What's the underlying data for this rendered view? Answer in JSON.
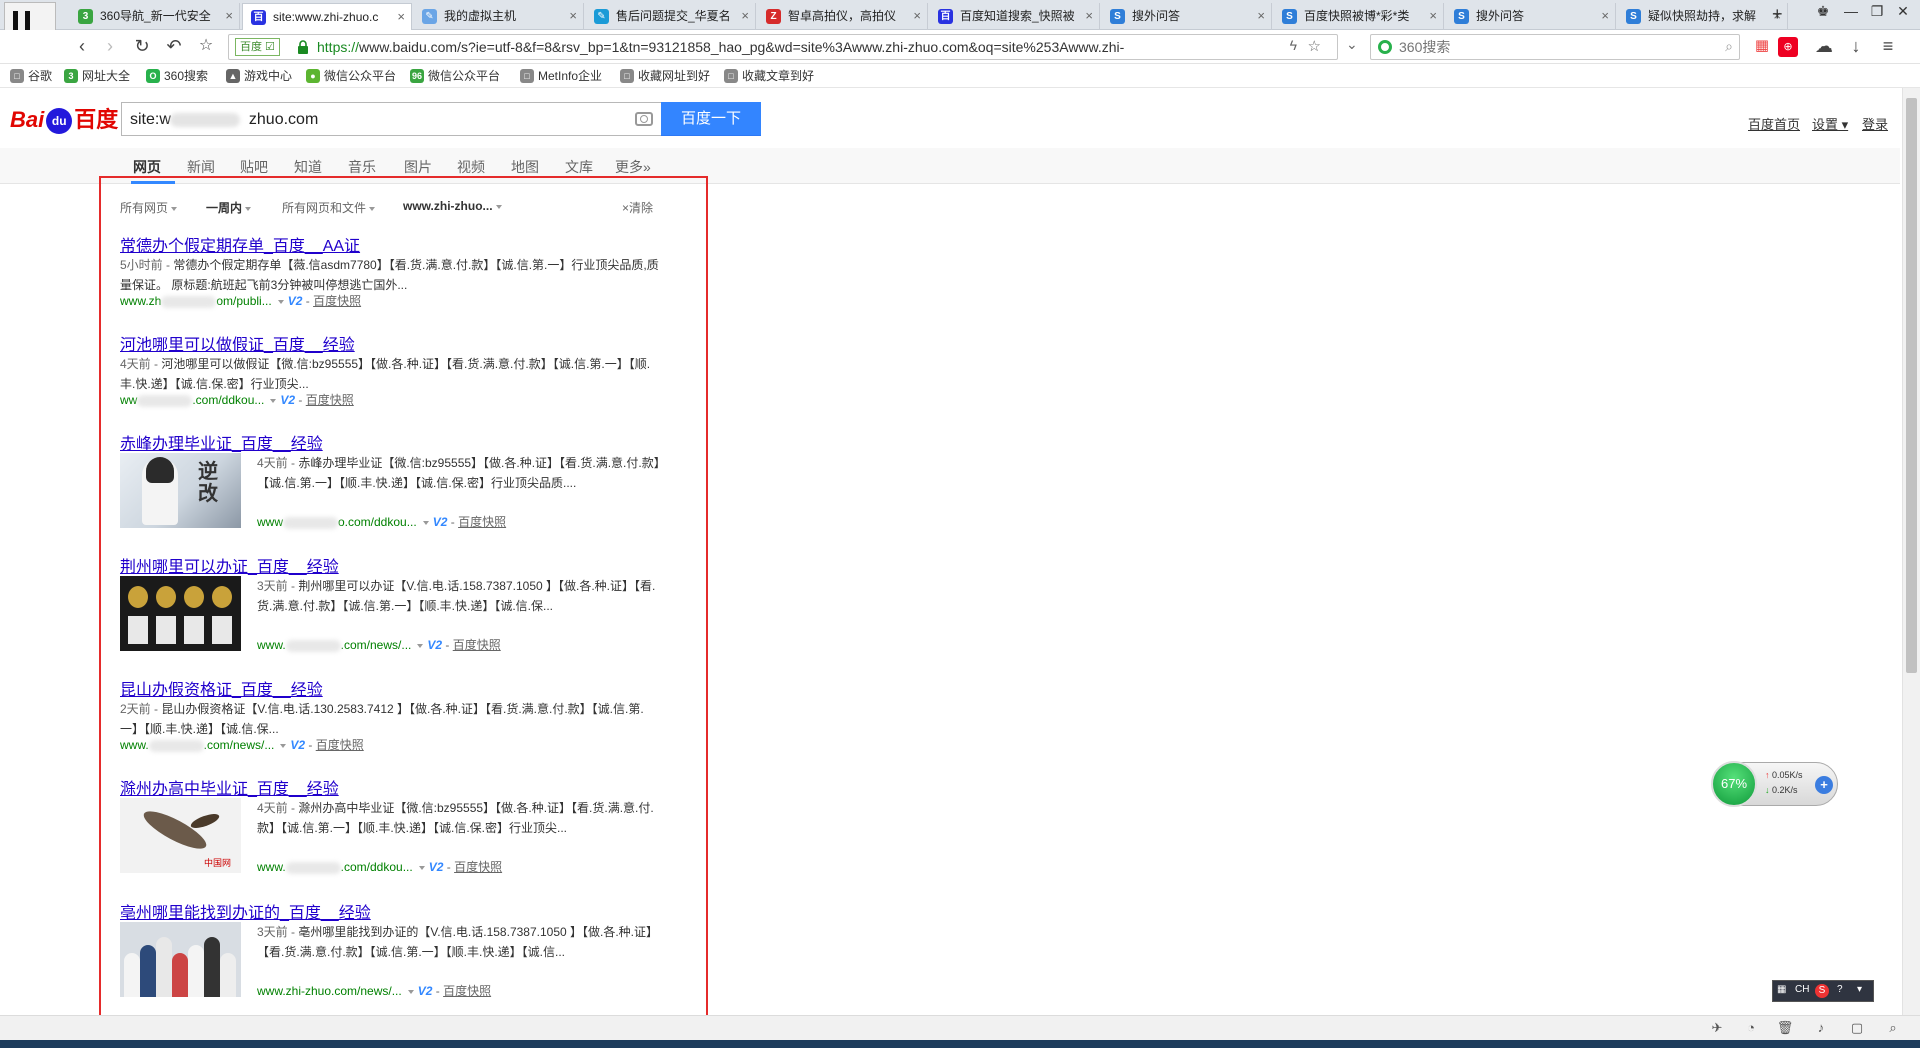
{
  "tabs": [
    {
      "label": "360导航_新一代安全",
      "fav_color": "#3aa541",
      "fav_text": "3",
      "active": false
    },
    {
      "label": "site:www.zhi-zhuo.c",
      "fav_color": "#2932e1",
      "fav_text": "百",
      "active": true
    },
    {
      "label": "我的虚拟主机",
      "fav_color": "#6aa5e6",
      "fav_text": "✎",
      "active": false
    },
    {
      "label": "售后问题提交_华夏名",
      "fav_color": "#1b9bd7",
      "fav_text": "✎",
      "active": false
    },
    {
      "label": "智卓高拍仪，高拍仪",
      "fav_color": "#d62b2b",
      "fav_text": "Z",
      "active": false
    },
    {
      "label": "百度知道搜索_快照被",
      "fav_color": "#2932e1",
      "fav_text": "百",
      "active": false
    },
    {
      "label": "搜外问答",
      "fav_color": "#2f7ed8",
      "fav_text": "S",
      "active": false
    },
    {
      "label": "百度快照被博*彩*类",
      "fav_color": "#2f7ed8",
      "fav_text": "S",
      "active": false
    },
    {
      "label": "搜外问答",
      "fav_color": "#2f7ed8",
      "fav_text": "S",
      "active": false
    },
    {
      "label": "疑似快照劫持，求解",
      "fav_color": "#2f7ed8",
      "fav_text": "S",
      "active": false
    }
  ],
  "address": {
    "site_badge": "百度 ☑",
    "scheme": "https://",
    "host": "www.baidu.com",
    "path": "/s?ie=utf-8&f=8&rsv_bp=1&tn=93121858_hao_pg&wd=site%3Awww.zhi-zhuo.com&oq=site%253Awww.zhi-"
  },
  "search": {
    "placeholder": "360搜索"
  },
  "bookmarks": [
    {
      "label": "谷歌",
      "color": "#888888",
      "icon": "□"
    },
    {
      "label": "网址大全",
      "color": "#3aa541",
      "icon": "3"
    },
    {
      "label": "360搜索",
      "color": "#28b14c",
      "icon": "O"
    },
    {
      "label": "游戏中心",
      "color": "#666666",
      "icon": "▲"
    },
    {
      "label": "微信公众平台",
      "color": "#5cb531",
      "icon": "●"
    },
    {
      "label": "微信公众平台",
      "color": "#3aa541",
      "icon": "96"
    },
    {
      "label": "MetInfo企业",
      "color": "#888888",
      "icon": "□"
    },
    {
      "label": "收藏网址到好",
      "color": "#888888",
      "icon": "□"
    },
    {
      "label": "收藏文章到好",
      "color": "#888888",
      "icon": "□"
    }
  ],
  "baidu": {
    "logo_a": "Bai",
    "logo_paw": "du",
    "logo_b": "百度",
    "query_prefix": "site:w",
    "query_suffix": "zhuo.com",
    "submit": "百度一下",
    "links": {
      "home": "百度首页",
      "settings": "设置",
      "login": "登录"
    },
    "nav_tabs": [
      "网页",
      "新闻",
      "贴吧",
      "知道",
      "音乐",
      "图片",
      "视频",
      "地图",
      "文库",
      "更多»"
    ],
    "filters": {
      "all_pages": "所有网页",
      "time": "一周内",
      "filetype": "所有网页和文件",
      "site": "www.zhi-zhuo...",
      "clear": "×清除"
    }
  },
  "results": [
    {
      "title": "常德办个假定期存单_百度__AA证",
      "time": "5小时前 - ",
      "abstract": "常德办个假定期存单【薇.信asdm7780】【看.货.满.意.付.款】【诚.信.第.一】行业顶尖品质,质量保证。 原标题:航班起飞前3分钟被叫停想逃亡国外...",
      "url_a": "www.zh",
      "url_b": "om/publi...",
      "v2": "V2",
      "snap": "百度快照",
      "thumb": null
    },
    {
      "title": "河池哪里可以做假证_百度__经验",
      "time": "4天前 - ",
      "abstract": "河池哪里可以做假证【微.信:bz95555】【做.各.种.证】【看.货.满.意.付.款】【诚.信.第.一】【顺.丰.快.递】【诚.信.保.密】行业顶尖...",
      "url_a": "ww",
      "url_b": ".com/ddkou...",
      "v2": "V2",
      "snap": "百度快照",
      "thumb": null
    },
    {
      "title": "赤峰办理毕业证_百度__经验",
      "time": "4天前 - ",
      "abstract": "赤峰办理毕业证【微.信:bz95555】【做.各.种.证】【看.货.满.意.付.款】【诚.信.第.一】【顺.丰.快.递】【诚.信.保.密】行业顶尖品质....",
      "url_a": "www",
      "url_b": "o.com/ddkou...",
      "v2": "V2",
      "snap": "百度快照",
      "thumb": "t1"
    },
    {
      "title": "荆州哪里可以办证_百度__经验",
      "time": "3天前 - ",
      "abstract": "荆州哪里可以办证【V.信.电.话.158.7387.1050 】【做.各.种.证】【看.货.满.意.付.款】【诚.信.第.一】【顺.丰.快.递】【诚.信.保...",
      "url_a": "www.",
      "url_b": ".com/news/...",
      "v2": "V2",
      "snap": "百度快照",
      "thumb": "t2"
    },
    {
      "title": "昆山办假资格证_百度__经验",
      "time": "2天前 - ",
      "abstract": "昆山办假资格证【V.信.电.话.130.2583.7412 】【做.各.种.证】【看.货.满.意.付.款】【诚.信.第.一】【顺.丰.快.递】【诚.信.保...",
      "url_a": "www.",
      "url_b": ".com/news/...",
      "v2": "V2",
      "snap": "百度快照",
      "thumb": null
    },
    {
      "title": "滁州办高中毕业证_百度__经验",
      "time": "4天前 - ",
      "abstract": "滁州办高中毕业证【微.信:bz95555】【做.各.种.证】【看.货.满.意.付.款】【诚.信.第.一】【顺.丰.快.递】【诚.信.保.密】行业顶尖...",
      "url_a": "www.",
      "url_b": ".com/ddkou...",
      "v2": "V2",
      "snap": "百度快照",
      "thumb": "t3"
    },
    {
      "title": "亳州哪里能找到办证的_百度__经验",
      "time": "3天前 - ",
      "abstract": "亳州哪里能找到办证的【V.信.电.话.158.7387.1050 】【做.各.种.证】【看.货.满.意.付.款】【诚.信.第.一】【顺.丰.快.递】【诚.信...",
      "url_a": "www.zhi-zhuo.com/news/...",
      "url_b": "",
      "v2": "V2",
      "snap": "百度快照",
      "thumb": "t4"
    }
  ],
  "thumb_text": {
    "t1": "逆\n改",
    "t3": "中国网"
  },
  "net_widget": {
    "percent": "67%",
    "up": "0.05K/s",
    "down": "0.2K/s"
  },
  "ime": {
    "lang": "CH",
    "brand": "S"
  }
}
